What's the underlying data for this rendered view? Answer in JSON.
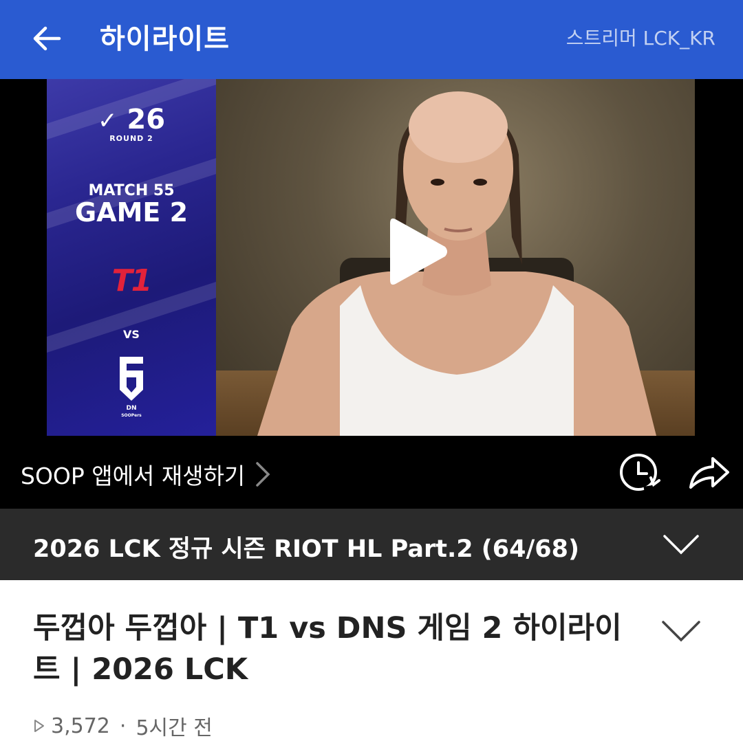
{
  "header": {
    "title": "하이라이트",
    "streamer_label": "스트리머 LCK_KR",
    "back_icon": "arrow-left-icon"
  },
  "thumbnail": {
    "season_logo": "26",
    "round": "ROUND 2",
    "match": "MATCH 55",
    "game": "GAME 2",
    "team1": "T1",
    "vs": "VS",
    "team2": "DN",
    "team2_sub": "SOOPers"
  },
  "player": {
    "open_in_app_label": "SOOP 앱에서 재생하기",
    "icons": [
      "play-icon",
      "chevron-right-icon",
      "watch-later-icon",
      "share-icon"
    ]
  },
  "playlist": {
    "title": "2026 LCK 정규 시즌 RIOT HL Part.2 (64/68)"
  },
  "video": {
    "title": "두껍아 두껍아 | T1 vs DNS 게임 2 하이라이트 | 2026 LCK",
    "views": "3,572",
    "separator": "·",
    "time_ago": "5시간 전"
  },
  "colors": {
    "header_bg": "#2a5bd1",
    "player_bg": "#000000",
    "playlist_bg": "#2b2b2b"
  }
}
